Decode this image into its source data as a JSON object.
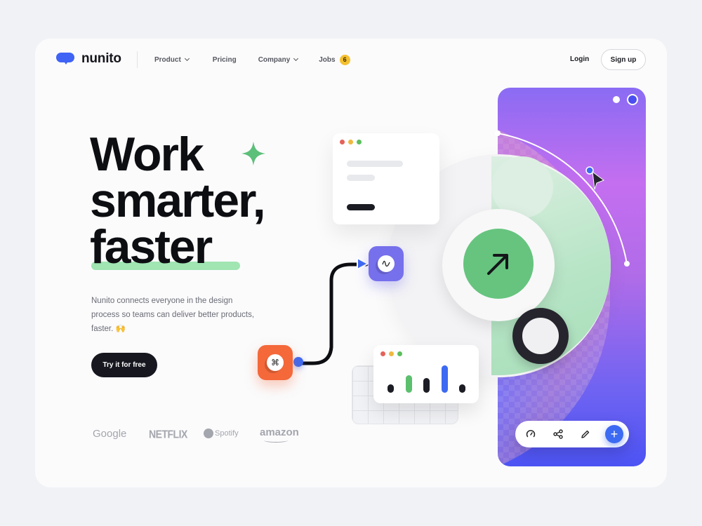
{
  "brand": {
    "name": "nunito",
    "logo_icon": "speech-bubble-icon",
    "color": "#3f63f5"
  },
  "nav": {
    "items": [
      {
        "label": "Product",
        "has_dropdown": true
      },
      {
        "label": "Pricing",
        "has_dropdown": false
      },
      {
        "label": "Company",
        "has_dropdown": true
      },
      {
        "label": "Jobs",
        "has_dropdown": false,
        "badge": "6"
      }
    ],
    "login_label": "Login",
    "signup_label": "Sign up"
  },
  "hero": {
    "headline_lines": [
      "Work",
      "smarter,",
      "faster"
    ],
    "description": "Nunito connects everyone in the design process so teams can deliver better products, faster. 🙌",
    "cta_label": "Try it for free",
    "accent_green": "#66c47e",
    "highlight_color": "#8fe0a4"
  },
  "logos": [
    "Google",
    "NETFLIX",
    "Spotify",
    "amazon"
  ],
  "illustration": {
    "trend_icon": "arrow-up-right-icon",
    "node_left_icon": "command-icon",
    "node_right_icon": "waveform-icon",
    "mini_chart_bars": [
      {
        "value": 0.25,
        "color": "#1b1c24"
      },
      {
        "value": 0.55,
        "color": "#5cbf6e"
      },
      {
        "value": 0.45,
        "color": "#1b1c24"
      },
      {
        "value": 0.85,
        "color": "#3d6af2"
      },
      {
        "value": 0.25,
        "color": "#1b1c24"
      }
    ],
    "toolbar": [
      "gauge-icon",
      "share-icon",
      "pencil-icon",
      "plus-icon"
    ],
    "panel_gradient": [
      "#8a6cf3",
      "#c46ef0",
      "#4c53f3"
    ]
  }
}
